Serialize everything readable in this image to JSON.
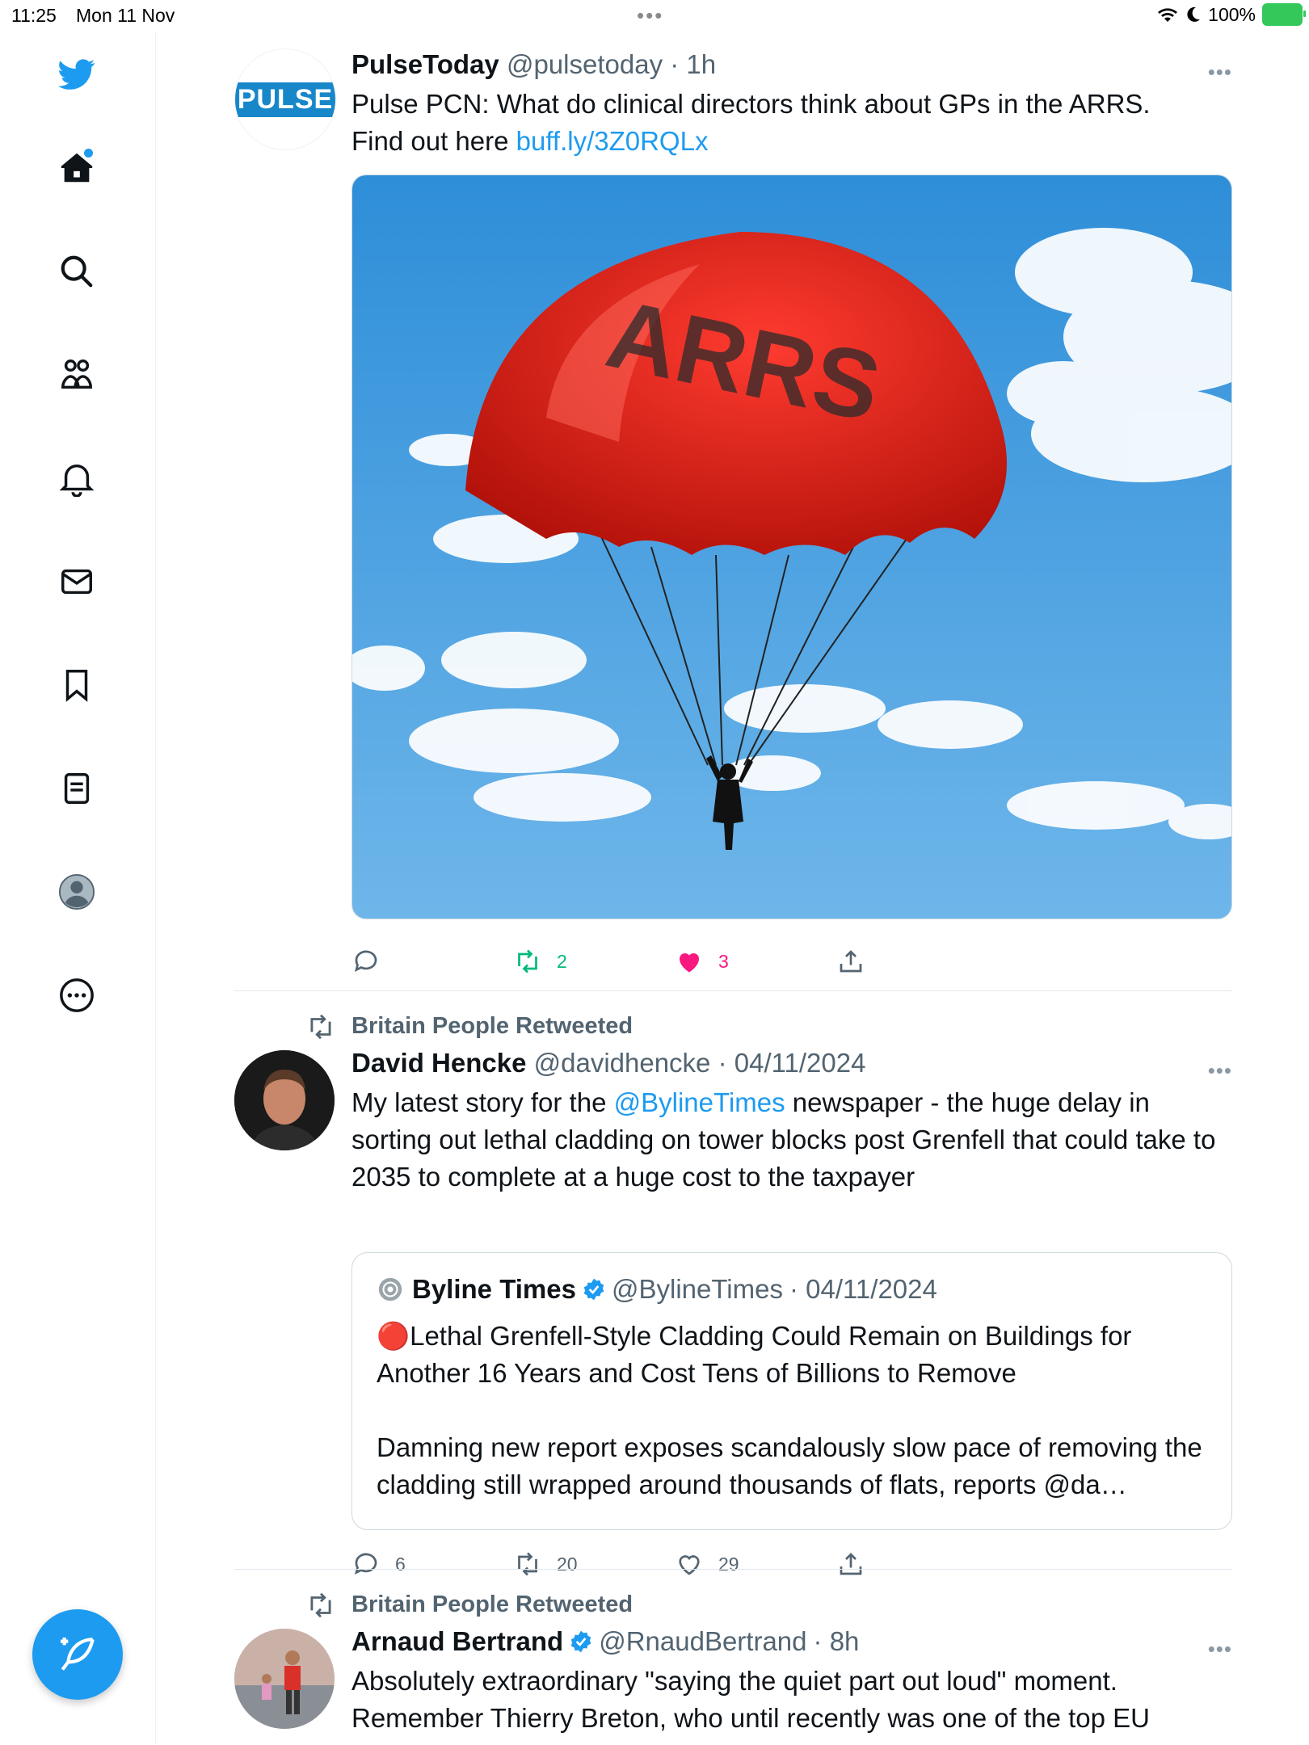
{
  "status_bar": {
    "time": "11:25",
    "date": "Mon 11 Nov",
    "dots": "•••",
    "battery": "100%"
  },
  "sidebar": {
    "items": [
      {
        "icon": "twitter-bird-icon"
      },
      {
        "icon": "home-icon"
      },
      {
        "icon": "search-icon"
      },
      {
        "icon": "communities-icon"
      },
      {
        "icon": "notifications-bell-icon"
      },
      {
        "icon": "messages-mail-icon"
      },
      {
        "icon": "bookmark-icon"
      },
      {
        "icon": "lists-icon"
      },
      {
        "icon": "profile-avatar-icon"
      },
      {
        "icon": "more-circle-icon"
      }
    ],
    "compose_icon": "compose-feather-icon"
  },
  "tweets": [
    {
      "name": "PulseToday",
      "handle": "@pulsetoday",
      "time": "· 1h",
      "avatar_text": "PULSE",
      "more": "•••",
      "text_line1": "Pulse PCN: What do clinical directors think about GPs in the ARRS.",
      "text_line2_prefix": "Find out here ",
      "link": "buff.ly/3Z0RQLx",
      "image_text": "ARRS",
      "actions": {
        "reply": "",
        "retweet": "2",
        "like": "3"
      }
    },
    {
      "retweeted_by": "Britain People Retweeted",
      "name": "David Hencke",
      "handle": "@davidhencke",
      "time": "· 04/11/2024",
      "more": "•••",
      "text_prefix": "My latest story for the ",
      "mention": "@BylineTimes",
      "text_suffix": " newspaper - the huge delay in sorting out lethal cladding on tower blocks post Grenfell that could take to 2035 to complete at a huge cost to the taxpayer",
      "quote": {
        "name": "Byline Times",
        "handle": "@BylineTimes",
        "time": "· 04/11/2024",
        "text1": "🔴Lethal Grenfell-Style Cladding Could Remain on Buildings for Another 16 Years and Cost Tens of Billions to Remove",
        "text2": "Damning new report exposes scandalously slow pace of removing the cladding still wrapped around thousands of flats, reports @da…"
      },
      "actions": {
        "reply": "6",
        "retweet": "20",
        "like": "29"
      }
    },
    {
      "retweeted_by": "Britain People Retweeted",
      "name": "Arnaud Bertrand",
      "handle": "@RnaudBertrand",
      "time": "· 8h",
      "more": "•••",
      "text": "Absolutely extraordinary \"saying the quiet part out loud\" moment. Remember Thierry Breton, who until recently was one of the top EU"
    }
  ],
  "colors": {
    "accent": "#1d9bf0",
    "retweet_green": "#00ba7c",
    "like_pink": "#f91880"
  }
}
